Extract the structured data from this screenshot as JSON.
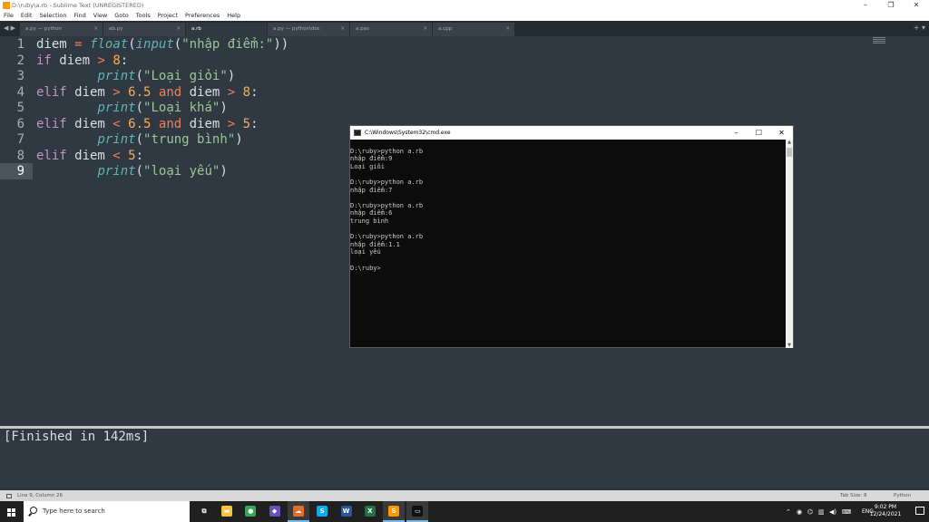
{
  "window": {
    "title": "D:\\ruby\\a.rb - Sublime Text (UNREGISTERED)",
    "controls": [
      "–",
      "❐",
      "✕"
    ]
  },
  "menu": [
    "File",
    "Edit",
    "Selection",
    "Find",
    "View",
    "Goto",
    "Tools",
    "Project",
    "Preferences",
    "Help"
  ],
  "tabs": [
    {
      "label": "a.py — python",
      "active": false
    },
    {
      "label": "ab.py",
      "active": false
    },
    {
      "label": "a.rb",
      "active": true
    },
    {
      "label": "a.py — python\\doc",
      "active": false
    },
    {
      "label": "a.pas",
      "active": false
    },
    {
      "label": "a.cpp",
      "active": false
    }
  ],
  "tab_nav": "◀ ▶",
  "tabbar_right": "+ ▾",
  "editor": {
    "current_line": 9,
    "lines": [
      {
        "n": "1",
        "tokens": [
          [
            "pl",
            "diem "
          ],
          [
            "op",
            "="
          ],
          [
            "pl",
            " "
          ],
          [
            "fn",
            "float"
          ],
          [
            "pl",
            "("
          ],
          [
            "fn",
            "input"
          ],
          [
            "pl",
            "("
          ],
          [
            "str",
            "\"nhập điểm:\""
          ],
          [
            "pl",
            "))"
          ]
        ]
      },
      {
        "n": "2",
        "tokens": [
          [
            "kw",
            "if"
          ],
          [
            "pl",
            " diem "
          ],
          [
            "op",
            ">"
          ],
          [
            "pl",
            " "
          ],
          [
            "num",
            "8"
          ],
          [
            "pl",
            ":"
          ]
        ]
      },
      {
        "n": "3",
        "tokens": [
          [
            "pl",
            "        "
          ],
          [
            "fn",
            "print"
          ],
          [
            "pl",
            "("
          ],
          [
            "str",
            "\"Loại giỏi\""
          ],
          [
            "pl",
            ")"
          ]
        ]
      },
      {
        "n": "4",
        "tokens": [
          [
            "kw",
            "elif"
          ],
          [
            "pl",
            " diem "
          ],
          [
            "op",
            ">"
          ],
          [
            "pl",
            " "
          ],
          [
            "num",
            "6.5"
          ],
          [
            "pl",
            " "
          ],
          [
            "op",
            "and"
          ],
          [
            "pl",
            " diem "
          ],
          [
            "op",
            ">"
          ],
          [
            "pl",
            " "
          ],
          [
            "num",
            "8"
          ],
          [
            "pl",
            ":"
          ]
        ]
      },
      {
        "n": "5",
        "tokens": [
          [
            "pl",
            "        "
          ],
          [
            "fn",
            "print"
          ],
          [
            "pl",
            "("
          ],
          [
            "str",
            "\"Loại khá\""
          ],
          [
            "pl",
            ")"
          ]
        ]
      },
      {
        "n": "6",
        "tokens": [
          [
            "kw",
            "elif"
          ],
          [
            "pl",
            " diem "
          ],
          [
            "op",
            "<"
          ],
          [
            "pl",
            " "
          ],
          [
            "num",
            "6.5"
          ],
          [
            "pl",
            " "
          ],
          [
            "op",
            "and"
          ],
          [
            "pl",
            " diem "
          ],
          [
            "op",
            ">"
          ],
          [
            "pl",
            " "
          ],
          [
            "num",
            "5"
          ],
          [
            "pl",
            ":"
          ]
        ]
      },
      {
        "n": "7",
        "tokens": [
          [
            "pl",
            "        "
          ],
          [
            "fn",
            "print"
          ],
          [
            "pl",
            "("
          ],
          [
            "str",
            "\"trung bình\""
          ],
          [
            "pl",
            ")"
          ]
        ]
      },
      {
        "n": "8",
        "tokens": [
          [
            "kw",
            "elif"
          ],
          [
            "pl",
            " diem "
          ],
          [
            "op",
            "<"
          ],
          [
            "pl",
            " "
          ],
          [
            "num",
            "5"
          ],
          [
            "pl",
            ":"
          ]
        ]
      },
      {
        "n": "9",
        "tokens": [
          [
            "pl",
            "        "
          ],
          [
            "fn",
            "print"
          ],
          [
            "pl",
            "("
          ],
          [
            "str",
            "\"loại yếu\""
          ],
          [
            "pl",
            ")"
          ]
        ]
      }
    ]
  },
  "cmd": {
    "title": "C:\\Windows\\System32\\cmd.exe",
    "controls": [
      "–",
      "☐",
      "✕"
    ],
    "lines": [
      "",
      "D:\\ruby>python a.rb",
      "nhập điểm:9",
      "Loại giỏi",
      "",
      "D:\\ruby>python a.rb",
      "nhập điểm:7",
      "",
      "D:\\ruby>python a.rb",
      "nhập điểm:6",
      "trung bình",
      "",
      "D:\\ruby>python a.rb",
      "nhập điểm:1.1",
      "loại yếu",
      "",
      "D:\\ruby>"
    ]
  },
  "output": {
    "text": "[Finished in 142ms]"
  },
  "status": {
    "position": "Line 9, Column 26",
    "tab_size": "Tab Size: 8",
    "syntax": "Python"
  },
  "taskbar": {
    "search_placeholder": "Type here to search",
    "apps": [
      {
        "name": "task-view",
        "color": "#202020",
        "glyph": "⧉"
      },
      {
        "name": "file-explorer",
        "color": "#f4c542",
        "glyph": "▬"
      },
      {
        "name": "chrome",
        "color": "#34a853",
        "glyph": "●"
      },
      {
        "name": "app-blue",
        "color": "#6b4fbb",
        "glyph": "◆"
      },
      {
        "name": "app-orange",
        "color": "#e36c2d",
        "glyph": "☁"
      },
      {
        "name": "skype",
        "color": "#00aff0",
        "glyph": "S"
      },
      {
        "name": "word",
        "color": "#2b579a",
        "glyph": "W"
      },
      {
        "name": "excel",
        "color": "#217346",
        "glyph": "X"
      },
      {
        "name": "sublime-text",
        "color": "#ff9800",
        "glyph": "S"
      },
      {
        "name": "cmd",
        "color": "#111111",
        "glyph": "▭"
      }
    ],
    "lang": "ENG",
    "time": "9:02 PM",
    "date": "12/24/2021"
  }
}
